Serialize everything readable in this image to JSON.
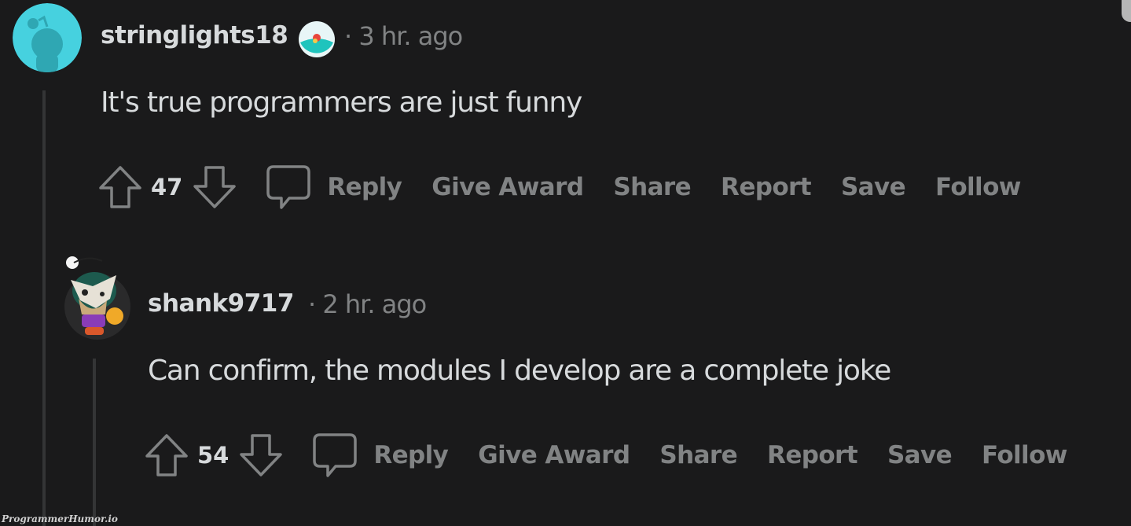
{
  "comments": [
    {
      "username": "stringlights18",
      "has_flair_badge": true,
      "timestamp": "· 3 hr. ago",
      "body": "It's true programmers are just funny",
      "votes": "47",
      "actions": [
        "Reply",
        "Give Award",
        "Share",
        "Report",
        "Save",
        "Follow"
      ],
      "avatar_color": "#46d1df"
    },
    {
      "username": "shank9717",
      "has_flair_badge": false,
      "timestamp": "· 2 hr. ago",
      "body": "Can confirm, the modules I develop are a complete joke",
      "votes": "54",
      "actions": [
        "Reply",
        "Give Award",
        "Share",
        "Report",
        "Save",
        "Follow"
      ],
      "avatar_color": "#2a2a2b"
    }
  ],
  "watermark": "ProgrammerHumor.io",
  "colors": {
    "background": "#1a1a1b",
    "text_primary": "#d7dadc",
    "text_secondary": "#818384",
    "thread_line": "#343536"
  }
}
